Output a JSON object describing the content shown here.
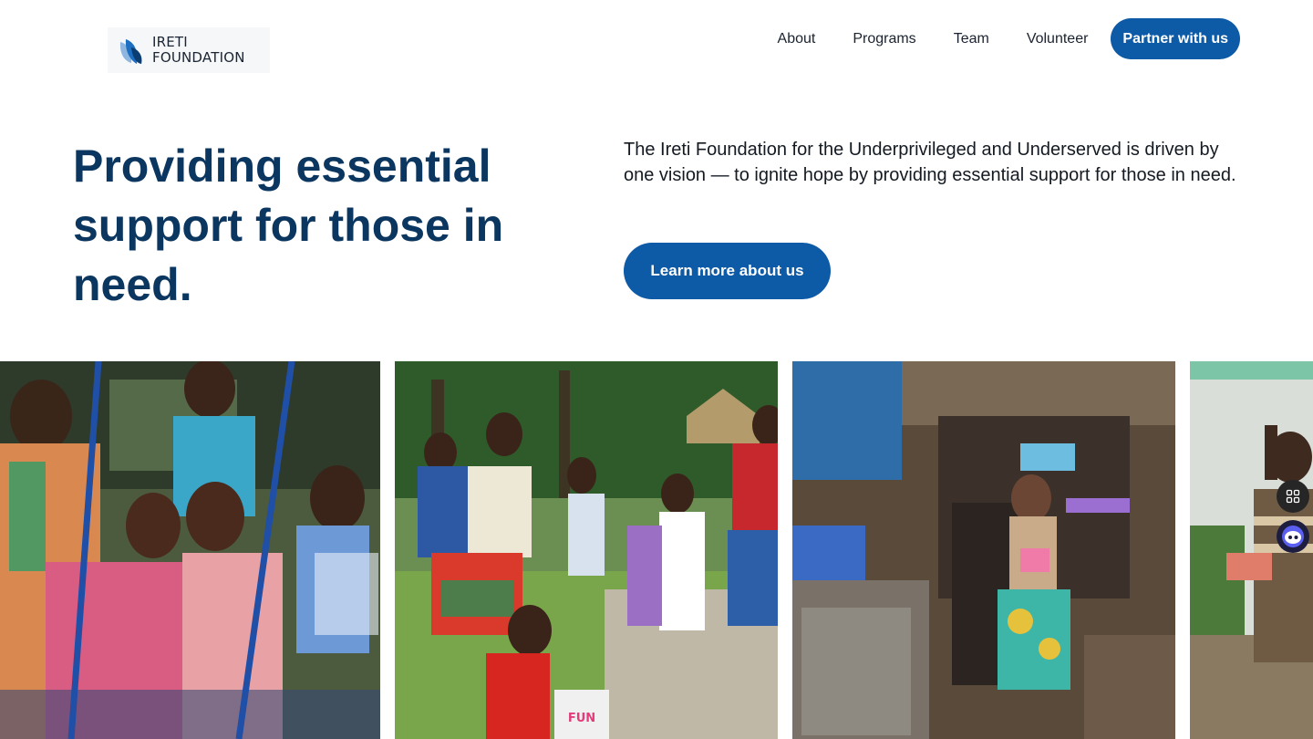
{
  "brand": {
    "name_line1": "IRETI",
    "name_line2": "FOUNDATION"
  },
  "nav": {
    "items": [
      {
        "label": "About"
      },
      {
        "label": "Programs"
      },
      {
        "label": "Team"
      },
      {
        "label": "Volunteer"
      }
    ],
    "cta_label": "Partner with us"
  },
  "hero": {
    "title": "Providing essential support for those in need.",
    "description": "The Ireti Foundation for the Underprivileged and Underserved is driven by one vision — to ignite hope by providing essential support for those in need.",
    "button_label": "Learn more about us"
  },
  "gallery": {
    "photos": [
      {
        "subject": "children-at-swings"
      },
      {
        "subject": "woman-with-microphone-and-children"
      },
      {
        "subject": "man-seated-at-market-stall"
      },
      {
        "subject": "boy-waving"
      }
    ]
  },
  "widgets": [
    {
      "icon": "grid-icon"
    },
    {
      "icon": "assistant-face-icon"
    }
  ],
  "colors": {
    "primary": "#0d5aa7",
    "heading": "#0b3660",
    "text": "#141a22"
  }
}
